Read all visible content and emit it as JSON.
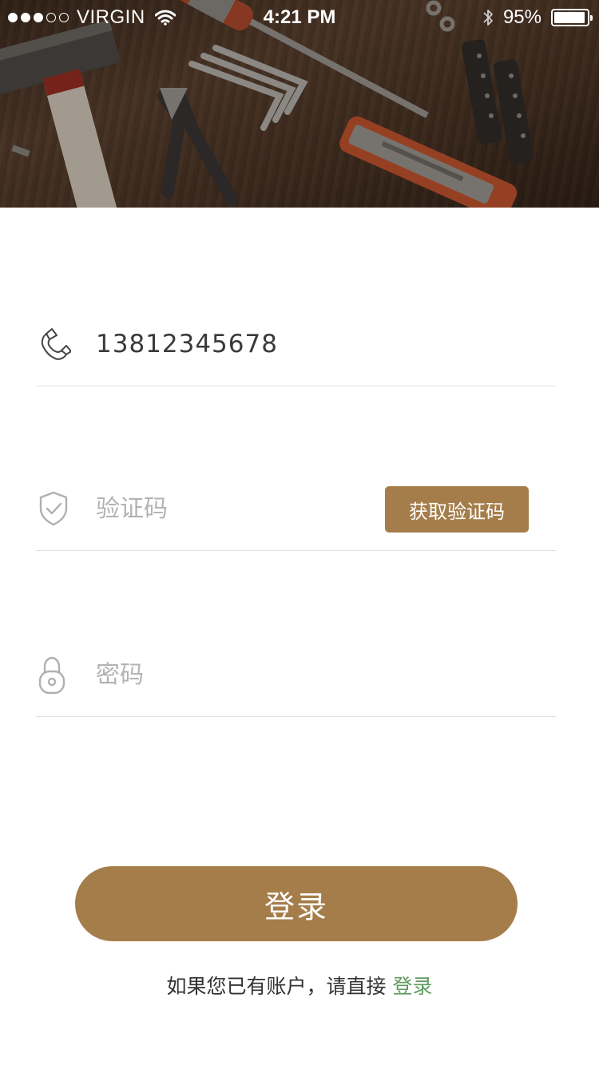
{
  "status_bar": {
    "carrier": "VIRGIN",
    "time": "4:21 PM",
    "battery_text": "95%",
    "battery_level": 0.95,
    "signal_bars_filled": 3,
    "signal_bars_total": 5
  },
  "hero": {
    "image": "tools-on-wooden-table"
  },
  "form": {
    "phone": {
      "value": "13812345678",
      "icon": "phone-icon"
    },
    "code": {
      "placeholder": "验证码",
      "icon": "shield-check-icon",
      "button_label": "获取验证码"
    },
    "password": {
      "placeholder": "密码",
      "icon": "lock-icon"
    }
  },
  "login_button": {
    "label": "登录"
  },
  "footer": {
    "prompt": "如果您已有账户，请直接",
    "link": "登录"
  },
  "colors": {
    "accent": "#a57d4a",
    "link": "#5f9b5f",
    "divider": "#e3e3e3",
    "placeholder": "#b3b3b3"
  }
}
